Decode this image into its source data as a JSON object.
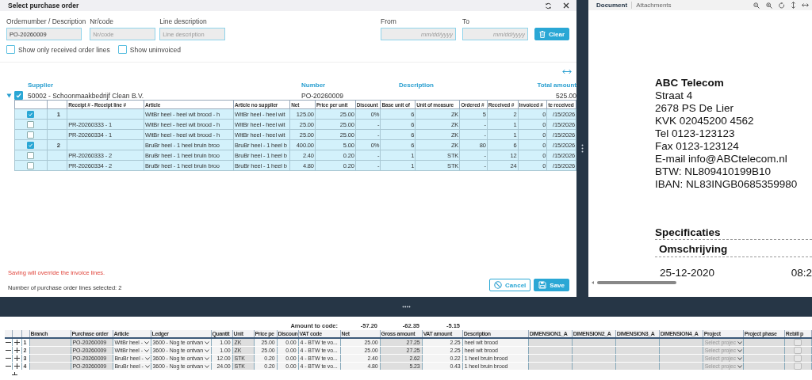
{
  "dialog": {
    "title": "Select purchase order",
    "filters": [
      {
        "kind": "text",
        "label": "Ordernumber / Description",
        "value": "PO-20260009"
      },
      {
        "kind": "text",
        "label": "Nr/code",
        "placeholder": "Nr/code"
      },
      {
        "kind": "text",
        "label": "Line description",
        "placeholder": "Line description"
      },
      {
        "kind": "date",
        "label": "From",
        "placeholder": "mm/dd/yyyy"
      },
      {
        "kind": "date",
        "label": "To",
        "placeholder": "mm/dd/yyyy"
      }
    ],
    "clear_button": "Clear",
    "options": [
      {
        "label": "Show only received order lines",
        "checked": false
      },
      {
        "label": "Show uninvoiced",
        "checked": false
      }
    ],
    "group_headers": [
      "Supplier",
      "Number",
      "Description",
      "Total amount"
    ],
    "group": {
      "expanded": true,
      "checked": true,
      "supplier": "50002 - Schoonmaakbedrijf Clean B.V.",
      "number": "PO-20260009",
      "total": "525.00"
    },
    "line_columns": [
      "Receipt # - Receipt line #",
      "Article",
      "Article no supplier",
      "Net",
      "Price per unit",
      "Discount",
      "Base unit of",
      "Unit of measure",
      "Ordered #",
      "Received #",
      "Invoiced #",
      "te received"
    ],
    "lines": [
      {
        "checked": true,
        "line": "1",
        "values": [
          "WitBr heel - heel wit brood - h",
          "WitBr heel - heel wit",
          "125.00",
          "25.00",
          "0%",
          "6",
          "ZK",
          "5",
          "2",
          "0",
          "/15/2026"
        ]
      },
      {
        "checked": false,
        "receipt": "PR-20260333 - 1",
        "values": [
          "WitBr heel - heel wit brood - h",
          "WitBr heel - heel wit",
          "25.00",
          "25.00",
          "-",
          "6",
          "ZK",
          "-",
          "1",
          "0",
          "/15/2026"
        ]
      },
      {
        "checked": false,
        "receipt": "PR-20260334 - 1",
        "values": [
          "WitBr heel - heel wit brood - h",
          "WitBr heel - heel wit",
          "25.00",
          "25.00",
          "-",
          "6",
          "ZK",
          "-",
          "1",
          "0",
          "/15/2026"
        ]
      },
      {
        "checked": true,
        "line": "2",
        "values": [
          "BruBr heel - 1 heel bruin broo",
          "BruBr heel - 1 heel b",
          "400.00",
          "5.00",
          "0%",
          "6",
          "ZK",
          "80",
          "6",
          "0",
          "/15/2026"
        ]
      },
      {
        "checked": false,
        "receipt": "PR-20260333 - 2",
        "values": [
          "BruBr heel - 1 heel bruin broo",
          "BruBr heel - 1 heel b",
          "2.40",
          "0.20",
          "-",
          "1",
          "STK",
          "-",
          "12",
          "0",
          "/15/2026"
        ]
      },
      {
        "checked": false,
        "receipt": "PR-20260334 - 2",
        "values": [
          "BruBr heel - 1 heel bruin broo",
          "BruBr heel - 1 heel b",
          "4.80",
          "0.20",
          "-",
          "1",
          "STK",
          "-",
          "24",
          "0",
          "/15/2026"
        ]
      }
    ],
    "warning": "Saving will override the invoice lines.",
    "selection_count": "Number of purchase order lines selected: 2",
    "buttons": [
      {
        "kind": "cancel",
        "label": "Cancel"
      },
      {
        "kind": "save",
        "label": "Save"
      }
    ]
  },
  "document_viewer": {
    "tabs": [
      {
        "label": "Document",
        "selected": true
      },
      {
        "label": "Attachments",
        "selected": false
      }
    ],
    "document": {
      "company": "ABC Telecom",
      "lines": [
        "Straat 4",
        "2678 PS De Lier",
        "KVK 02045200 4562",
        "Tel  0123-123123",
        "Fax 0123-123124",
        "E-mail info@ABCtelecom.nl",
        "BTW: NL809410199B10",
        "IBAN: NL83INGB0685359980"
      ],
      "section": "Specificaties",
      "column_heading": "Omschrijving",
      "row": [
        "25-12-2020",
        "08:2"
      ]
    }
  },
  "coding": {
    "amount_label": "Amount to code:",
    "amounts": [
      "-57.20",
      "-62.35",
      "-5.15"
    ],
    "columns": [
      "Branch",
      "Purchase order",
      "Article",
      "Ledger",
      "Quantit",
      "Unit",
      "Price pe",
      "Discoun",
      "VAT code",
      "Net",
      "Gross amount",
      "VAT amount",
      "Description",
      "DIMENSION1_A",
      "DIMENSION2_A",
      "DIMENSION3_A",
      "DIMENSION4_A",
      "Project",
      "Project phase",
      "Rebill p"
    ],
    "rows": [
      {
        "line": "1",
        "purchase_order": "PO-20260009",
        "article": "WitBr heel -",
        "ledger": "3600 - Nog te ontvan",
        "quantity": "1.00",
        "unit": "ZK",
        "price": "25.00",
        "discount": "0.00",
        "vat_code": "4 - BTW te vo...",
        "net": "25.00",
        "gross": "27.25",
        "vat": "2.25",
        "description": "heel wit brood",
        "project_placeholder": "Select projec",
        "rebill": false
      },
      {
        "line": "2",
        "purchase_order": "PO-20260009",
        "article": "WitBr heel -",
        "ledger": "3600 - Nog te ontvan",
        "quantity": "1.00",
        "unit": "ZK",
        "price": "25.00",
        "discount": "0.00",
        "vat_code": "4 - BTW te vo...",
        "net": "25.00",
        "gross": "27.25",
        "vat": "2.25",
        "description": "heel wit brood",
        "project_placeholder": "Select projec",
        "rebill": false
      },
      {
        "line": "3",
        "purchase_order": "PO-20260009",
        "article": "BruBr heel -",
        "ledger": "3600 - Nog te ontvan",
        "quantity": "12.00",
        "unit": "STK",
        "price": "0.20",
        "discount": "0.00",
        "vat_code": "4 - BTW te vo...",
        "net": "2.40",
        "gross": "2.62",
        "vat": "0.22",
        "description": "1 heel bruin brood",
        "project_placeholder": "Select projec",
        "rebill": false
      },
      {
        "line": "4",
        "purchase_order": "PO-20260009",
        "article": "BruBr heel -",
        "ledger": "3600 - Nog te ontvan",
        "quantity": "24.00",
        "unit": "STK",
        "price": "0.20",
        "discount": "0.00",
        "vat_code": "4 - BTW te vo...",
        "net": "4.80",
        "gross": "5.23",
        "vat": "0.43",
        "description": "1 heel bruin brood",
        "project_placeholder": "Select projec",
        "rebill": false
      }
    ]
  }
}
